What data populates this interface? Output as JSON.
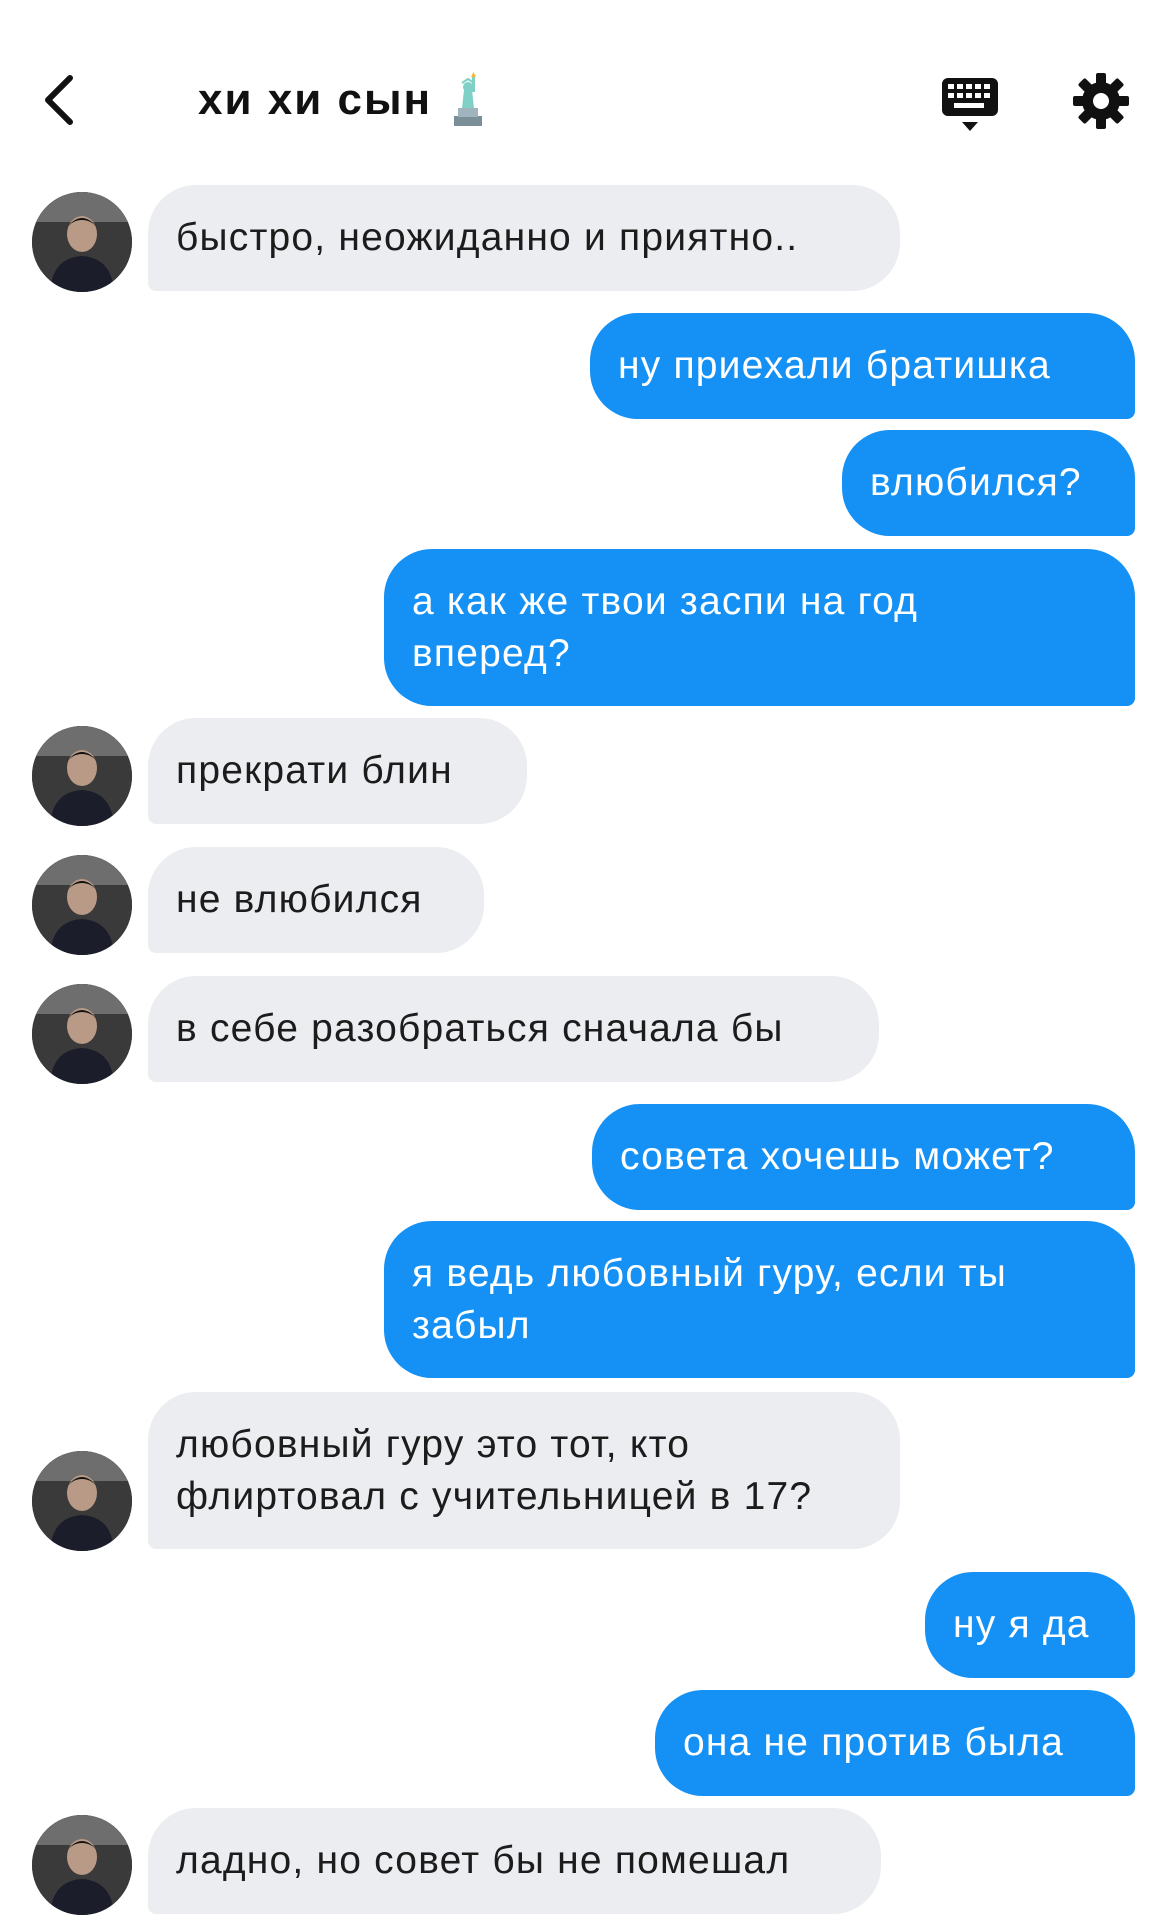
{
  "header": {
    "title": "хи хи сын",
    "title_emoji": "statue-of-liberty"
  },
  "colors": {
    "outgoing_bubble": "#1591f5",
    "incoming_bubble": "#ecedf1",
    "text_dark": "#1c1c1c"
  },
  "messages": [
    {
      "direction": "incoming",
      "text": "быстро, неожиданно и приятно.."
    },
    {
      "direction": "outgoing",
      "text": "ну приехали братишка"
    },
    {
      "direction": "outgoing",
      "text": "влюбился?"
    },
    {
      "direction": "outgoing",
      "lines": [
        "а как же твои заспи на год",
        "вперед?"
      ]
    },
    {
      "direction": "incoming",
      "text": "прекрати блин"
    },
    {
      "direction": "incoming",
      "text": "не влюбился"
    },
    {
      "direction": "incoming",
      "text": "в себе разобраться сначала бы"
    },
    {
      "direction": "outgoing",
      "text": "совета хочешь может?"
    },
    {
      "direction": "outgoing",
      "lines": [
        "я ведь любовный гуру, если ты",
        "забыл"
      ]
    },
    {
      "direction": "incoming",
      "lines": [
        "любовный гуру это тот, кто",
        "флиртовал с учительницей в 17?"
      ]
    },
    {
      "direction": "outgoing",
      "text": "ну я да"
    },
    {
      "direction": "outgoing",
      "text": "она не против была"
    },
    {
      "direction": "incoming",
      "text": "ладно, но совет бы не помешал"
    }
  ]
}
